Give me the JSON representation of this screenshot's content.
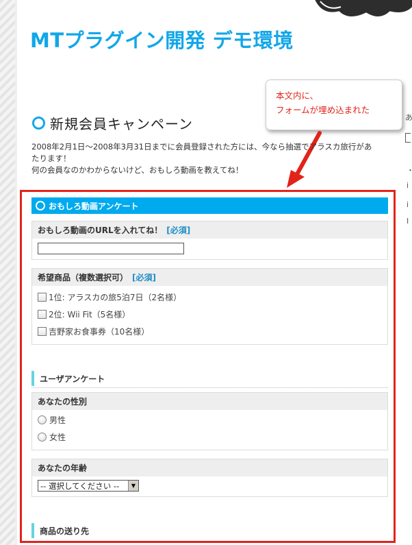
{
  "site": {
    "title": "MTプラグイン開発 デモ環境"
  },
  "callout": {
    "line1": "本文内に、",
    "line2": "フォームが埋め込まれた"
  },
  "entry": {
    "title": "新規会員キャンペーン",
    "intro_line1": "2008年2月1日～2008年3月31日までに会員登録された方には、今なら抽選でアラスカ旅行があ",
    "intro_line2": "たります！",
    "intro_line3": "何の会員なのかわからないけど、おもしろ動画を教えてね！"
  },
  "form": {
    "title": "おもしろ動画アンケート",
    "q1": {
      "label": "おもしろ動画のURLを入れてね！",
      "required": "[必須]",
      "value": ""
    },
    "q2": {
      "label": "希望商品（複数選択可）",
      "required": "[必須]",
      "options": [
        "1位: アラスカの旅5泊7日（2名様）",
        "2位: Wii Fit（5名様）",
        "吉野家お食事券（10名様）"
      ]
    },
    "section_user": "ユーザアンケート",
    "q3": {
      "label": "あなたの性別",
      "options": [
        "男性",
        "女性"
      ]
    },
    "q4": {
      "label": "あなたの年齢",
      "selected": "-- 選択してください --"
    },
    "section_ship": "商品の送り先"
  },
  "colors": {
    "accent": "#12a7e8",
    "frame": "#e2231a",
    "form_bar": "#00aaee"
  }
}
